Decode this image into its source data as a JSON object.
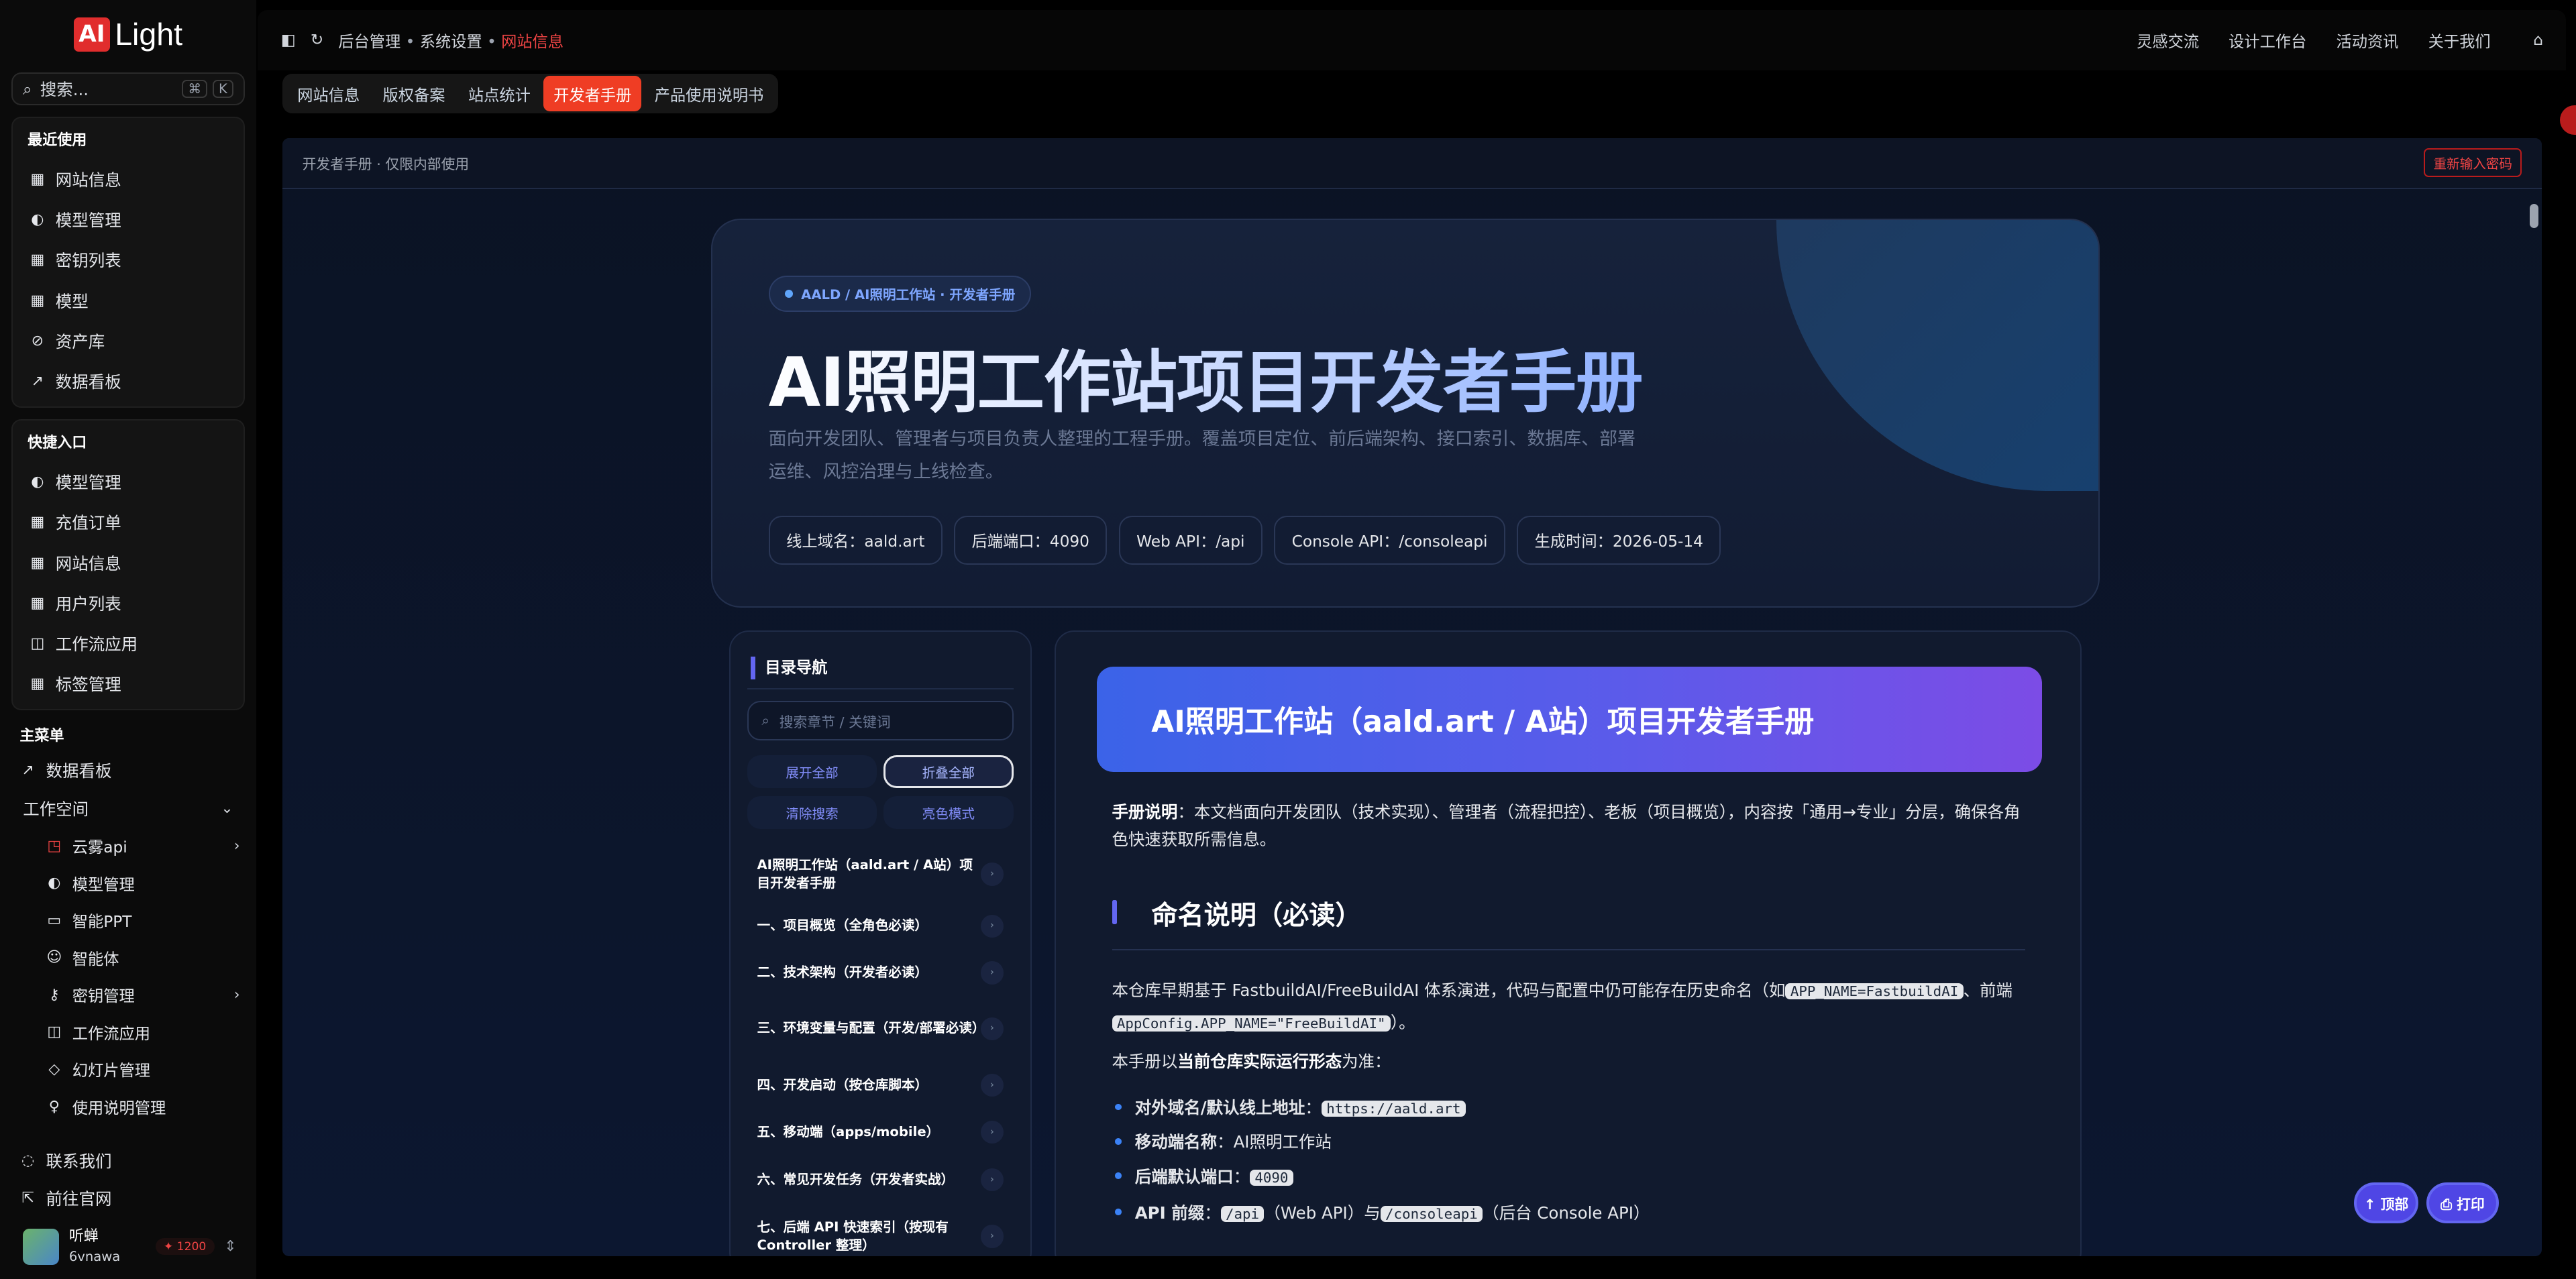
{
  "app": {
    "logo_mark": "AI",
    "logo_text": "Light",
    "search_placeholder": "搜索...",
    "kbd1": "⌘",
    "kbd2": "K"
  },
  "sidebar": {
    "recent": {
      "title": "最近使用",
      "items": [
        "网站信息",
        "模型管理",
        "密钥列表",
        "模型",
        "资产库",
        "数据看板"
      ]
    },
    "quick": {
      "title": "快捷入口",
      "items": [
        "模型管理",
        "充值订单",
        "网站信息",
        "用户列表",
        "工作流应用",
        "标签管理"
      ]
    },
    "main": {
      "title": "主菜单",
      "dashboard": "数据看板",
      "workspace": "工作空间",
      "sub": [
        "云雾api",
        "模型管理",
        "智能PPT",
        "智能体",
        "密钥管理",
        "工作流应用",
        "幻灯片管理",
        "使用说明管理"
      ]
    },
    "footer": {
      "contact": "联系我们",
      "official": "前往官网"
    },
    "user": {
      "name": "听蝉",
      "handle": "6vnawa",
      "credits": "1200"
    }
  },
  "topbar": {
    "crumbs": [
      "后台管理",
      "系统设置",
      "网站信息"
    ],
    "nav": [
      "灵感交流",
      "设计工作台",
      "活动资讯",
      "关于我们"
    ]
  },
  "tabs": [
    "网站信息",
    "版权备案",
    "站点统计",
    "开发者手册",
    "产品使用说明书"
  ],
  "content": {
    "bar_title": "开发者手册 · 仅限内部使用",
    "reenter": "重新输入密码",
    "hero": {
      "badge": "AALD / AI照明工作站 · 开发者手册",
      "title": "AI照明工作站项目开发者手册",
      "desc": "面向开发团队、管理者与项目负责人整理的工程手册。覆盖项目定位、前后端架构、接口索引、数据库、部署运维、风控治理与上线检查。",
      "chips": [
        "线上域名：aald.art",
        "后端端口：4090",
        "Web API：/api",
        "Console API：/consoleapi",
        "生成时间：2026-05-14"
      ]
    },
    "toc": {
      "title": "目录导航",
      "search_placeholder": "搜索章节 / 关键词",
      "buttons": [
        "展开全部",
        "折叠全部",
        "清除搜索",
        "亮色模式"
      ],
      "items": [
        "AI照明工作站（aald.art / A站）项目开发者手册",
        "一、项目概览（全角色必读）",
        "二、技术架构（开发者必读）",
        "三、环境变量与配置（开发/部署必读）",
        "四、开发启动（按仓库脚本）",
        "五、移动端（apps/mobile）",
        "六、常见开发任务（开发者实战）",
        "七、后端 API 快速索引（按现有 Controller 整理）"
      ],
      "arrow": "›"
    },
    "doc": {
      "header": "AI照明工作站（aald.art / A站）项目开发者手册",
      "intro_label": "手册说明",
      "intro_text": "：本文档面向开发团队（技术实现）、管理者（流程把控）、老板（项目概览），内容按「通用→专业」分层，确保各角色快速获取所需信息。",
      "h2": "命名说明（必读）",
      "p1_a": "本仓库早期基于 FastbuildAI/FreeBuildAI 体系演进，代码与配置中仍可能存在历史命名（如",
      "p1_code1": "APP_NAME=FastbuildAI",
      "p1_b": "、前端",
      "p1_code2": "AppConfig.APP_NAME=\"FreeBuildAI\"",
      "p1_c": "）。",
      "p2_a": "本手册以",
      "p2_b": "当前仓库实际运行形态",
      "p2_c": "为准：",
      "b1_label": "对外域名/默认线上地址",
      "b1_code": "https://aald.art",
      "b2_label": "移动端名称",
      "b2_text": "AI照明工作站",
      "b3_label": "后端默认端口",
      "b3_code": "4090",
      "b4_label": "API 前缀",
      "b4_code1": "/api",
      "b4_t1": "（Web API）与",
      "b4_code2": "/consoleapi",
      "b4_t2": "（后台 Console API）"
    },
    "float": {
      "top": "↑ 顶部",
      "print": "⎙ 打印"
    }
  },
  "colors": {
    "accent": "#ef3d24",
    "indigo": "#6366f1"
  }
}
